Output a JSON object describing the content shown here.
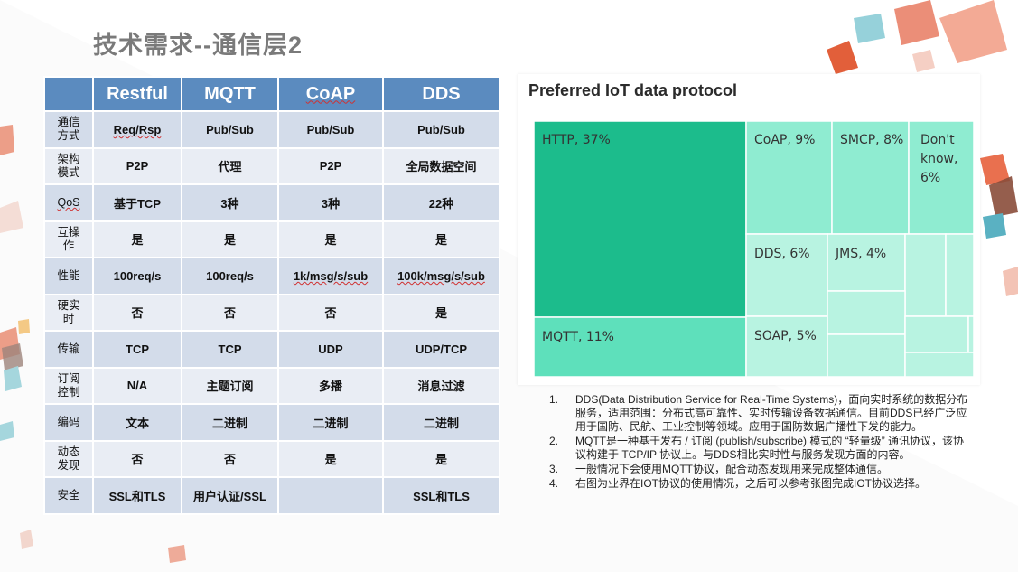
{
  "slide": {
    "title": "技术需求--通信层2"
  },
  "table": {
    "headers": [
      "",
      "Restful",
      "MQTT",
      "CoAP",
      "DDS"
    ],
    "rows": [
      {
        "label": "通信\n方式",
        "cells": [
          "Req/Rsp",
          "Pub/Sub",
          "Pub/Sub",
          "Pub/Sub"
        ]
      },
      {
        "label": "架构\n模式",
        "cells": [
          "P2P",
          "代理",
          "P2P",
          "全局数据空间"
        ]
      },
      {
        "label": "QoS",
        "cells": [
          "基于TCP",
          "3种",
          "3种",
          "22种"
        ]
      },
      {
        "label": "互操\n作",
        "cells": [
          "是",
          "是",
          "是",
          "是"
        ]
      },
      {
        "label": "性能",
        "cells": [
          "100req/s",
          "100req/s",
          "1k/msg/s/sub",
          "100k/msg/s/sub"
        ]
      },
      {
        "label": "硬实\n时",
        "cells": [
          "否",
          "否",
          "否",
          "是"
        ]
      },
      {
        "label": "传输",
        "cells": [
          "TCP",
          "TCP",
          "UDP",
          "UDP/TCP"
        ]
      },
      {
        "label": "订阅\n控制",
        "cells": [
          "N/A",
          "主题订阅",
          "多播",
          "消息过滤"
        ]
      },
      {
        "label": "编码",
        "cells": [
          "文本",
          "二进制",
          "二进制",
          "二进制"
        ]
      },
      {
        "label": "动态\n发现",
        "cells": [
          "否",
          "否",
          "是",
          "是"
        ]
      },
      {
        "label": "安全",
        "cells": [
          "SSL和TLS",
          "用户认证/SSL",
          "",
          "SSL和TLS"
        ]
      }
    ]
  },
  "chart_data": {
    "type": "treemap",
    "title": "Preferred IoT data protocol",
    "items": [
      {
        "name": "HTTP",
        "label": "HTTP, 37%",
        "value": 37
      },
      {
        "name": "MQTT",
        "label": "MQTT, 11%",
        "value": 11
      },
      {
        "name": "CoAP",
        "label": "CoAP, 9%",
        "value": 9
      },
      {
        "name": "SMCP",
        "label": "SMCP, 8%",
        "value": 8
      },
      {
        "name": "Don't know",
        "label": "Don't\nknow,\n6%",
        "value": 6
      },
      {
        "name": "DDS",
        "label": "DDS, 6%",
        "value": 6
      },
      {
        "name": "JMS",
        "label": "JMS, 4%",
        "value": 4
      },
      {
        "name": "SOAP",
        "label": "SOAP, 5%",
        "value": 5
      }
    ],
    "colors": {
      "dark": "#1cbc8c",
      "mid": "#5ee0bb",
      "light": "#8fecd1",
      "lighter": "#b8f3e1"
    }
  },
  "notes": [
    {
      "num": "1.",
      "text": "DDS(Data Distribution Service for Real-Time Systems)，面向实时系统的数据分布服务，适用范围：分布式高可靠性、实时传输设备数据通信。目前DDS已经广泛应用于国防、民航、工业控制等领域。应用于国防数据广播性下发的能力。"
    },
    {
      "num": "2.",
      "text": "MQTT是一种基于发布 / 订阅 (publish/subscribe) 模式的 “轻量级” 通讯协议，该协议构建于 TCP/IP 协议上。与DDS相比实时性与服务发现方面的内容。"
    },
    {
      "num": "3.",
      "text": "一般情况下会使用MQTT协议，配合动态发现用来完成整体通信。"
    },
    {
      "num": "4.",
      "text": "右图为业界在IOT协议的使用情况，之后可以参考张图完成IOT协议选择。"
    }
  ]
}
